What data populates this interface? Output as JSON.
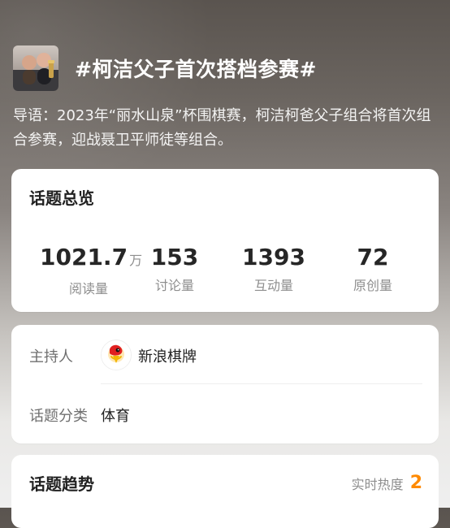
{
  "header": {
    "title": "#柯洁父子首次搭档参赛#",
    "avatar_icon": "photo-avatar"
  },
  "intro": {
    "text": "导语：2023年“丽水山泉”杯围棋赛，柯洁柯爸父子组合将首次组合参赛，迎战聂卫平师徒等组合。"
  },
  "overview": {
    "title": "话题总览",
    "stats": [
      {
        "value": "1021.7",
        "unit": "万",
        "label": "阅读量"
      },
      {
        "value": "153",
        "unit": "",
        "label": "讨论量"
      },
      {
        "value": "1393",
        "unit": "",
        "label": "互动量"
      },
      {
        "value": "72",
        "unit": "",
        "label": "原创量"
      }
    ]
  },
  "info": {
    "host_label": "主持人",
    "host_name": "新浪棋牌",
    "host_icon": "sina-logo-icon",
    "category_label": "话题分类",
    "category_value": "体育"
  },
  "trend": {
    "title": "话题趋势",
    "heat_label": "实时热度",
    "heat_value": "2",
    "accent": "#ff8a00"
  }
}
